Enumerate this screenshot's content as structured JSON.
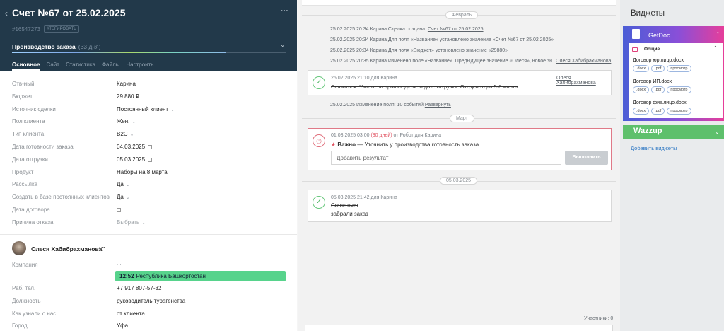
{
  "deal": {
    "back": "‹",
    "title": "Счет №67 от 25.02.2025",
    "menu": "···",
    "id": "#16547273",
    "tag": "#ТЕГИРОВАТЬ",
    "stage": "Производство заказа",
    "stage_days": "(33 дня)",
    "stage_progress": 0.78,
    "tabs": [
      "Основное",
      "Сайт",
      "Статистика",
      "Файлы",
      "Настроить"
    ]
  },
  "fields": [
    {
      "label": "Отв-ный",
      "value": "Карина",
      "type": "text"
    },
    {
      "label": "Бюджет",
      "value": "29 880  ₽",
      "type": "text"
    },
    {
      "label": "Источник сделки",
      "value": "Постоянный клиент",
      "type": "select"
    },
    {
      "label": "Пол клиента",
      "value": "Жен.",
      "type": "select"
    },
    {
      "label": "Тип клиента",
      "value": "B2C",
      "type": "select"
    },
    {
      "label": "Дата готовности заказа",
      "value": "04.03.2025",
      "type": "date"
    },
    {
      "label": "Дата отгрузки",
      "value": "05.03.2025",
      "type": "date"
    },
    {
      "label": "Продукт",
      "value": "Наборы на 8 марта",
      "type": "text"
    },
    {
      "label": "Рассылка",
      "value": "Да",
      "type": "select"
    },
    {
      "label": "Создать в базе постоянных клиентов",
      "value": "Да",
      "type": "select"
    },
    {
      "label": "Дата договора",
      "value": "",
      "type": "date"
    },
    {
      "label": "Причина отказа",
      "value": "Выбрать",
      "type": "select-muted"
    }
  ],
  "contact": {
    "name": "Олеся Хабибрахманова",
    "menu": "···",
    "company_label": "Компания",
    "company_value": "...",
    "time_badge_time": "12:52",
    "time_badge_region": "Республика Башкортостан",
    "fields": [
      {
        "label": "Раб. тел.",
        "value": "+7 917 807-57-32",
        "underline": true
      },
      {
        "label": "Должность",
        "value": "руководитель турагенства"
      },
      {
        "label": "Как узнали о нас",
        "value": "от клиента"
      },
      {
        "label": "Город",
        "value": "Уфа"
      }
    ]
  },
  "feed": {
    "pill_february": "Февраль",
    "log": [
      {
        "text": "25.02.2025 20:34 Карина Сделка создана: ",
        "link": "Счет №67 от 25.02.2025"
      },
      {
        "text": "25.02.2025 20:34 Карина Для поля «Название» установлено значение «Счет №67 от 25.02.2025»",
        "link": ""
      },
      {
        "text": "25.02.2025 20:34 Карина Для поля «Бюджет» установлено значение «29880»",
        "link": ""
      },
      {
        "text": "25.02.2025 20:35 Карина Изменено поле «Название». Предыдущее значение «Олеся», новое зн",
        "link": ""
      }
    ],
    "log_right": "Олеся Хабибрахманова",
    "task1": {
      "meta": "25.02.2025 21:10  для Карина",
      "right": "Олеся Хабибрахманова",
      "text": "Связаться: Узнать на производстве о дате отгрузки. Отгрузить до 5-6 марта"
    },
    "collapsed": "25.02.2025 Изменение поля: 10 событий ",
    "collapsed_link": "Развернуть",
    "pill_march": "Март",
    "task2": {
      "meta_date": "01.03.2025 03:00 ",
      "meta_overdue": "(30 дней)",
      "meta_rest": " от Робот для Карина",
      "important_label": "Важно",
      "text": " — Уточнить у производства готовность заказа",
      "placeholder": "Добавить результат",
      "button": "Выполнить"
    },
    "pill_date": "05.03.2025",
    "task3": {
      "meta": "05.03.2025 21:42  для Карина",
      "title": "Связаться",
      "result": "забрали заказ"
    },
    "participants": "Участники: 0"
  },
  "widgets": {
    "title": "Виджеты",
    "getdoc": {
      "title": "GetDoc",
      "folder": "Общие",
      "docs": [
        {
          "name": "Договор юр.лицо.docx",
          "chips": [
            ".docx",
            ".pdf",
            "просмотр"
          ]
        },
        {
          "name": "Договор ИП.docx",
          "chips": [
            ".docx",
            ".pdf",
            "просмотр"
          ]
        },
        {
          "name": "Договор физ.лицо.docx",
          "chips": [
            ".docx",
            ".pdf",
            "просмотр"
          ]
        }
      ]
    },
    "wazzup": "Wazzup",
    "add": "Добавить виджеты"
  }
}
